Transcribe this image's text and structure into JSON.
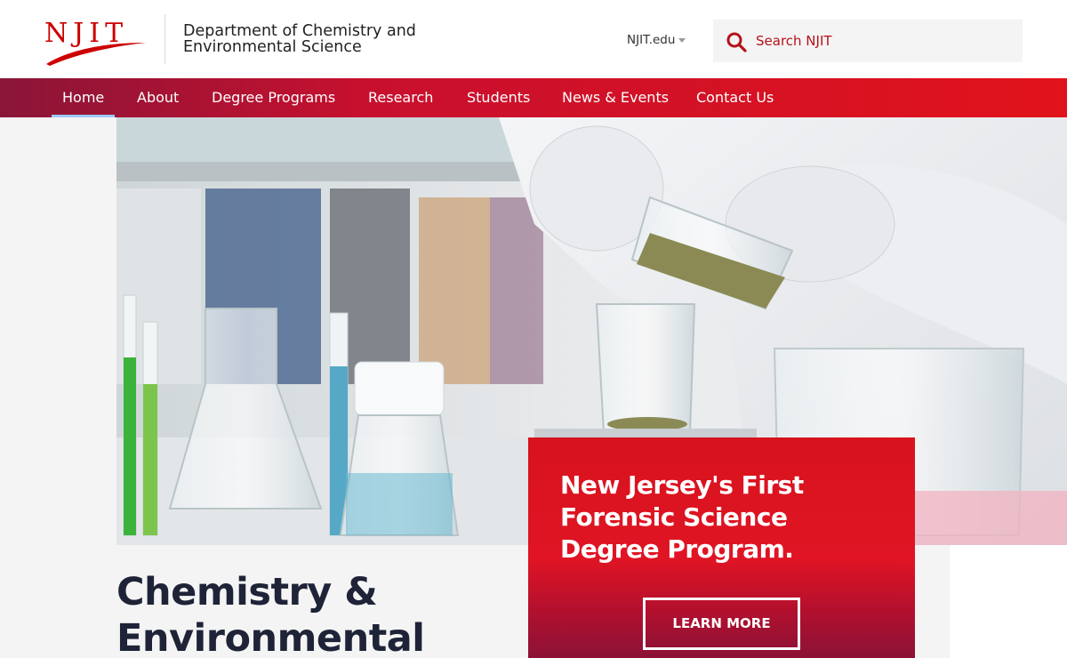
{
  "header": {
    "logo_text": "NJIT",
    "department": "Department of Chemistry and Environmental Science",
    "njit_link": "NJIT.edu",
    "search_placeholder": "Search NJIT"
  },
  "nav": {
    "items": [
      {
        "label": "Home",
        "active": true
      },
      {
        "label": "About"
      },
      {
        "label": "Degree Programs"
      },
      {
        "label": "Research"
      },
      {
        "label": "Students"
      },
      {
        "label": "News & Events"
      },
      {
        "label": "Contact Us"
      }
    ]
  },
  "hero": {
    "image": "lab-glassware-photo",
    "heading": "Chemistry & Environmental",
    "promo_title": "New Jersey's First Forensic Science Degree Program.",
    "cta_label": "LEARN MORE"
  },
  "colors": {
    "brand_red": "#d7131d",
    "brand_maroon": "#8a1538",
    "heading_navy": "#1e2337"
  }
}
